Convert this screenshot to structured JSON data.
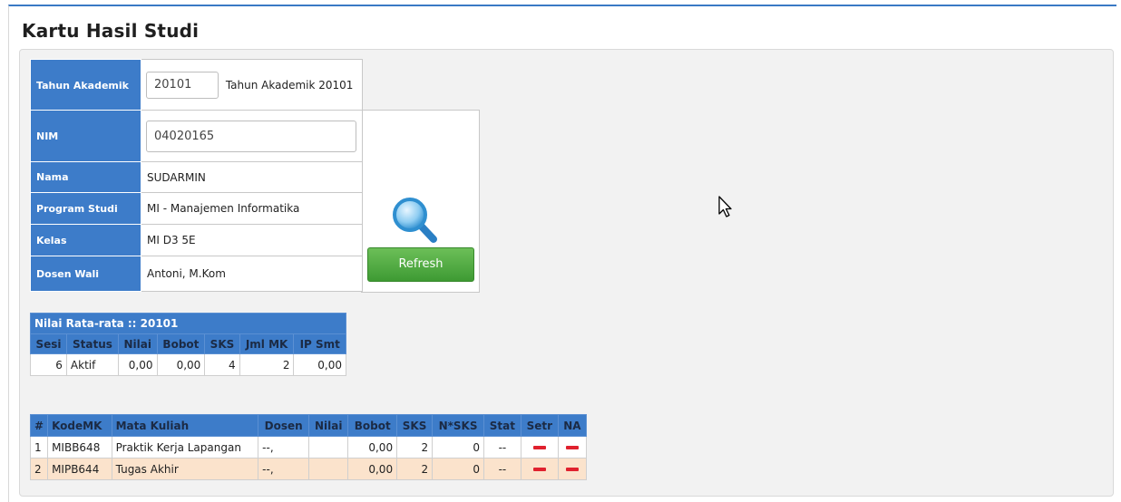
{
  "page_title": "Kartu Hasil Studi",
  "form": {
    "tahun_label": "Tahun Akademik",
    "tahun_value": "20101",
    "tahun_text": "Tahun Akademik 20101",
    "nim_label": "NIM",
    "nim_value": "04020165",
    "nama_label": "Nama",
    "nama_value": "SUDARMIN",
    "prodi_label": "Program Studi",
    "prodi_value": "MI - Manajemen Informatika",
    "kelas_label": "Kelas",
    "kelas_value": "MI D3 5E",
    "dosen_label": "Dosen Wali",
    "dosen_value": "Antoni, M.Kom",
    "refresh_label": "Refresh"
  },
  "summary": {
    "caption": "Nilai Rata-rata :: 20101",
    "headers": [
      "Sesi",
      "Status",
      "Nilai",
      "Bobot",
      "SKS",
      "Jml MK",
      "IP Smt"
    ],
    "row": [
      "6",
      "Aktif",
      "0,00",
      "0,00",
      "4",
      "2",
      "0,00"
    ]
  },
  "courses": {
    "headers": [
      "#",
      "KodeMK",
      "Mata Kuliah",
      "Dosen",
      "Nilai",
      "Bobot",
      "SKS",
      "N*SKS",
      "Stat",
      "Setr",
      "NA"
    ],
    "rows": [
      {
        "no": "1",
        "kode": "MIBB648",
        "mk": "Praktik Kerja Lapangan",
        "dosen": "--,",
        "nilai": "",
        "bobot": "0,00",
        "sks": "2",
        "nsks": "0",
        "stat": "--"
      },
      {
        "no": "2",
        "kode": "MIPB644",
        "mk": "Tugas Akhir",
        "dosen": "--,",
        "nilai": "",
        "bobot": "0,00",
        "sks": "2",
        "nsks": "0",
        "stat": "--"
      }
    ]
  },
  "colors": {
    "header_blue": "#3d7cc9",
    "refresh_green": "#4caf3f",
    "delete_red": "#e0212e",
    "alt_row": "#fbe3cc"
  },
  "icons": {
    "search": "magnifier-icon",
    "delete": "minus-icon",
    "cursor": "mouse-pointer-icon"
  }
}
